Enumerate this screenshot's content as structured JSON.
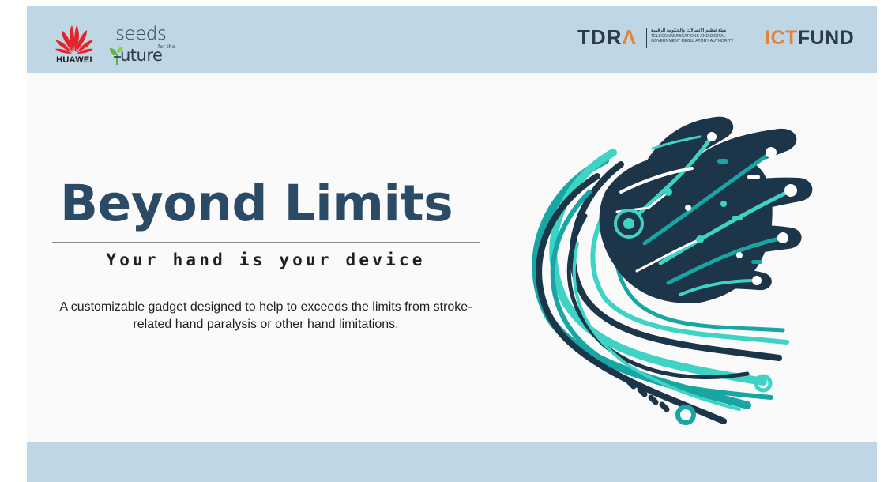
{
  "header": {
    "huawei_label": "HUAWEI",
    "seeds_word": "seeds",
    "seeds_for_the": "for the",
    "seeds_future": "uture",
    "tdra_mark": "TDR",
    "tdra_arabic": "هيئة تنظيم الاتصالات والحكومة الرقمية",
    "tdra_en_line1": "TELECOMMUNICATIONS AND DIGITAL",
    "tdra_en_line2": "GOVERNMENT REGULATORY AUTHORITY",
    "ict": "ICT",
    "fund": "FUND"
  },
  "main": {
    "title": "Beyond Limits",
    "subtitle": "Your hand is your device",
    "description": "A customizable gadget designed to help to exceeds the limits from stroke-related hand paralysis or other hand limitations."
  },
  "colors": {
    "bar": "#bfd6e5",
    "title": "#2a4a66",
    "navy": "#1c3549",
    "teal": "#17a6a3",
    "aqua": "#3fd3c6",
    "huawei_red": "#e3242b",
    "ict_orange": "#e3843a"
  },
  "icons": {
    "huawei": "huawei-petal-logo",
    "seeds": "sprout-logo",
    "illustration": "circuit-hand-illustration"
  }
}
